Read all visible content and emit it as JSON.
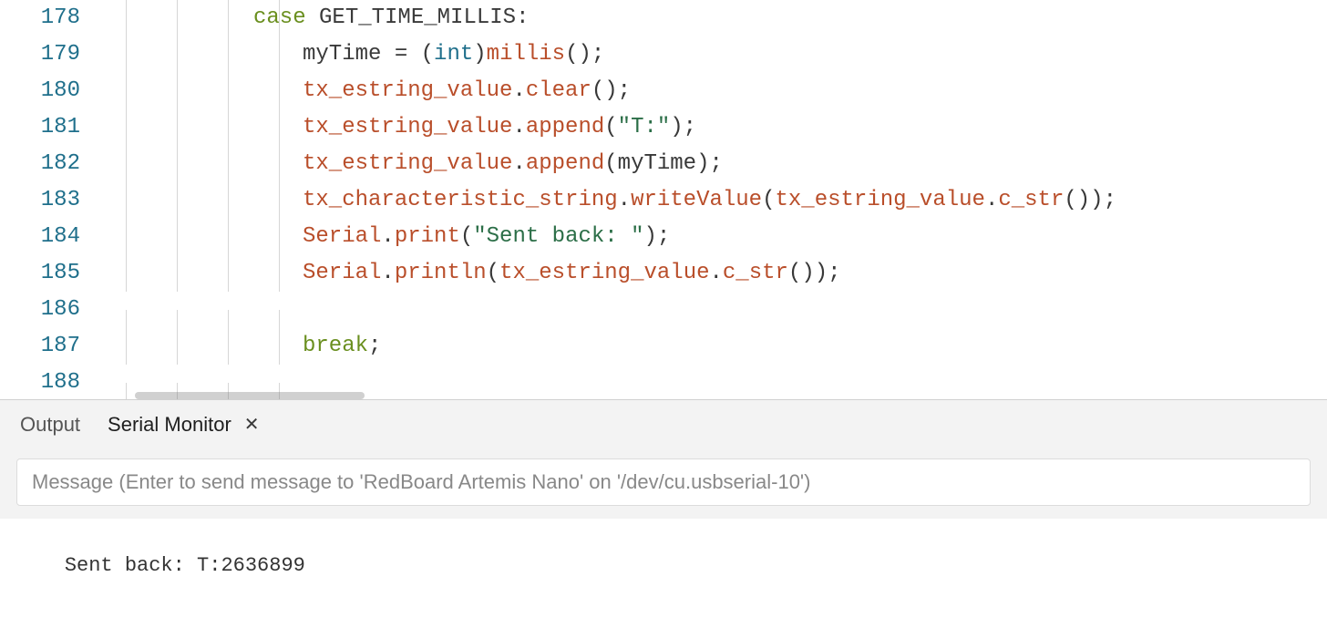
{
  "editor": {
    "lines": [
      {
        "num": 178,
        "indent": 1,
        "tokens": [
          {
            "t": "case ",
            "c": "tok-kw"
          },
          {
            "t": "GET_TIME_MILLIS",
            "c": "tok-const"
          },
          {
            "t": ":",
            "c": "tok-punct"
          }
        ]
      },
      {
        "num": 179,
        "indent": 2,
        "tokens": [
          {
            "t": "myTime ",
            "c": "tok-const"
          },
          {
            "t": "= ",
            "c": "tok-op"
          },
          {
            "t": "(",
            "c": "tok-punct"
          },
          {
            "t": "int",
            "c": "tok-type"
          },
          {
            "t": ")",
            "c": "tok-punct"
          },
          {
            "t": "millis",
            "c": "tok-fn"
          },
          {
            "t": "();",
            "c": "tok-punct"
          }
        ]
      },
      {
        "num": 180,
        "indent": 2,
        "tokens": [
          {
            "t": "tx_estring_value",
            "c": "tok-obj"
          },
          {
            "t": ".",
            "c": "tok-punct"
          },
          {
            "t": "clear",
            "c": "tok-fn"
          },
          {
            "t": "();",
            "c": "tok-punct"
          }
        ]
      },
      {
        "num": 181,
        "indent": 2,
        "tokens": [
          {
            "t": "tx_estring_value",
            "c": "tok-obj"
          },
          {
            "t": ".",
            "c": "tok-punct"
          },
          {
            "t": "append",
            "c": "tok-fn"
          },
          {
            "t": "(",
            "c": "tok-punct"
          },
          {
            "t": "\"T:\"",
            "c": "tok-str"
          },
          {
            "t": ");",
            "c": "tok-punct"
          }
        ]
      },
      {
        "num": 182,
        "indent": 2,
        "tokens": [
          {
            "t": "tx_estring_value",
            "c": "tok-obj"
          },
          {
            "t": ".",
            "c": "tok-punct"
          },
          {
            "t": "append",
            "c": "tok-fn"
          },
          {
            "t": "(myTime);",
            "c": "tok-punct"
          }
        ]
      },
      {
        "num": 183,
        "indent": 2,
        "tokens": [
          {
            "t": "tx_characteristic_string",
            "c": "tok-obj"
          },
          {
            "t": ".",
            "c": "tok-punct"
          },
          {
            "t": "writeValue",
            "c": "tok-fn"
          },
          {
            "t": "(",
            "c": "tok-punct"
          },
          {
            "t": "tx_estring_value",
            "c": "tok-obj"
          },
          {
            "t": ".",
            "c": "tok-punct"
          },
          {
            "t": "c_str",
            "c": "tok-fn"
          },
          {
            "t": "());",
            "c": "tok-punct"
          }
        ]
      },
      {
        "num": 184,
        "indent": 2,
        "tokens": [
          {
            "t": "Serial",
            "c": "tok-obj"
          },
          {
            "t": ".",
            "c": "tok-punct"
          },
          {
            "t": "print",
            "c": "tok-fn"
          },
          {
            "t": "(",
            "c": "tok-punct"
          },
          {
            "t": "\"Sent back: \"",
            "c": "tok-str"
          },
          {
            "t": ");",
            "c": "tok-punct"
          }
        ]
      },
      {
        "num": 185,
        "indent": 2,
        "tokens": [
          {
            "t": "Serial",
            "c": "tok-obj"
          },
          {
            "t": ".",
            "c": "tok-punct"
          },
          {
            "t": "println",
            "c": "tok-fn"
          },
          {
            "t": "(",
            "c": "tok-punct"
          },
          {
            "t": "tx_estring_value",
            "c": "tok-obj"
          },
          {
            "t": ".",
            "c": "tok-punct"
          },
          {
            "t": "c_str",
            "c": "tok-fn"
          },
          {
            "t": "());",
            "c": "tok-punct"
          }
        ]
      },
      {
        "num": 186,
        "indent": 2,
        "tokens": []
      },
      {
        "num": 187,
        "indent": 2,
        "tokens": [
          {
            "t": "break",
            "c": "tok-kw"
          },
          {
            "t": ";",
            "c": "tok-punct"
          }
        ]
      },
      {
        "num": 188,
        "indent": 0,
        "tokens": []
      }
    ]
  },
  "panel": {
    "tabs": {
      "output_label": "Output",
      "serial_label": "Serial Monitor"
    },
    "serial_input_placeholder": "Message (Enter to send message to 'RedBoard Artemis Nano' on '/dev/cu.usbserial-10')",
    "serial_output": "Sent back: T:2636899"
  }
}
